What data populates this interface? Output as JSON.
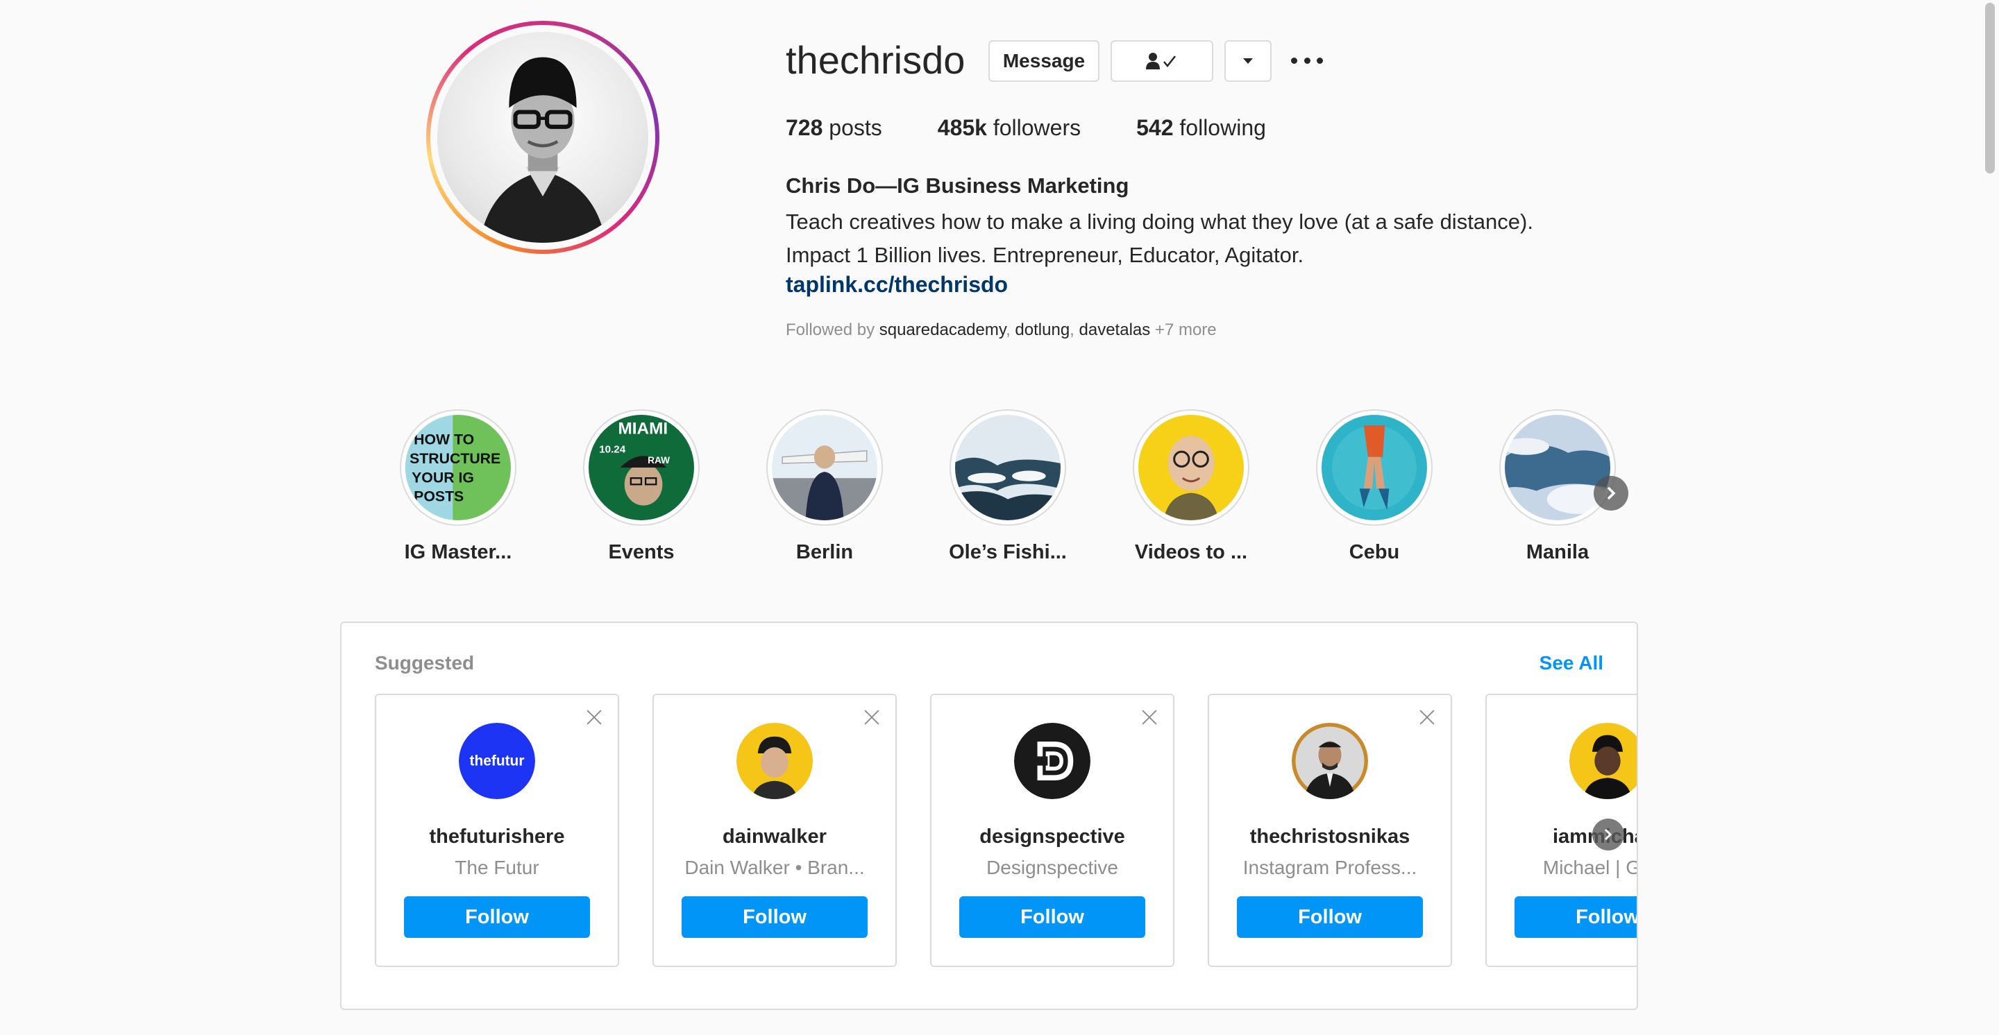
{
  "profile": {
    "username": "thechrisdo",
    "message_label": "Message",
    "following_icon": "person-check-icon",
    "dropdown_icon": "caret-down-icon",
    "more_icon": "more-dots-icon",
    "stats": {
      "posts_count": "728",
      "posts_label": " posts",
      "followers_count": "485k",
      "followers_label": " followers",
      "following_count": "542",
      "following_label": " following"
    },
    "full_name": "Chris Do—IG Business Marketing",
    "bio_line1": "Teach creatives how to make a living doing what they love (at a safe distance).",
    "bio_line2": "Impact 1 Billion lives. Entrepreneur, Educator, Agitator.",
    "link": "taplink.cc/thechrisdo",
    "followed_by_prefix": "Followed by ",
    "followed_by_users": [
      "squaredacademy",
      "dotlung",
      "davetalas"
    ],
    "followed_by_sep": ", ",
    "followed_by_more": " +7 more"
  },
  "highlights": {
    "items": [
      {
        "label": "IG Master..."
      },
      {
        "label": "Events"
      },
      {
        "label": "Berlin"
      },
      {
        "label": "Ole’s Fishi..."
      },
      {
        "label": "Videos to ..."
      },
      {
        "label": "Cebu"
      },
      {
        "label": "Manila"
      }
    ],
    "cover_texts": {
      "ig_master": [
        "HOW TO",
        "STRUCTURE",
        "YOUR IG",
        "POSTS"
      ],
      "events_top": "MIAMI",
      "events_date": "10.24",
      "events_cap": "RAW"
    },
    "next_icon": "chevron-right-icon"
  },
  "suggested": {
    "title": "Suggested",
    "see_all": "See All",
    "follow_label": "Follow",
    "cards": [
      {
        "username": "thefuturishere",
        "subtitle": "The Futur",
        "avatar_text": "thefutur",
        "avatar_color": "#1d34f5"
      },
      {
        "username": "dainwalker",
        "subtitle": "Dain Walker • Bran...",
        "avatar_color": "#f5c518"
      },
      {
        "username": "designspective",
        "subtitle": "Designspective",
        "avatar_color": "#1a1a1a"
      },
      {
        "username": "thechristosnikas",
        "subtitle": "Instagram Profess...",
        "avatar_color": "#2b2b2b"
      },
      {
        "username": "iammichael",
        "subtitle": "Michael | Grow",
        "avatar_color": "#f5c518"
      }
    ],
    "next_icon": "chevron-right-icon"
  },
  "colors": {
    "accent_blue": "#0095f6",
    "link_blue": "#00376b",
    "muted": "#8e8e8e",
    "border": "#dbdbdb"
  }
}
